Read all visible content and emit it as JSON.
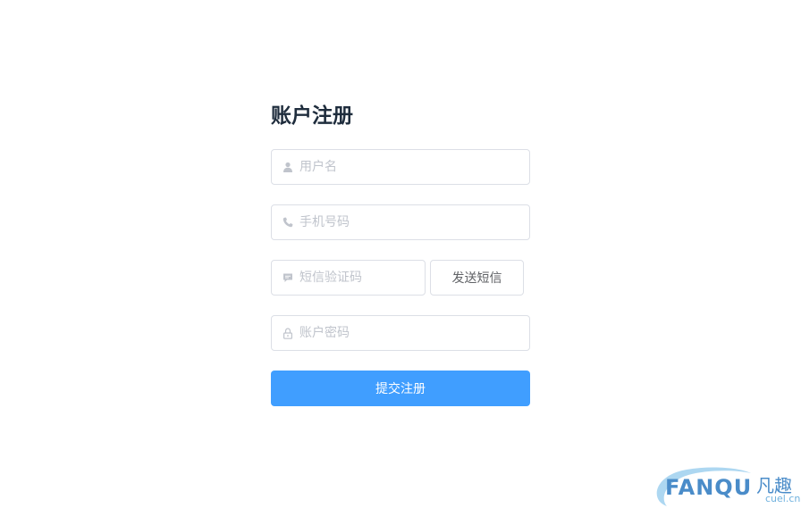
{
  "form": {
    "title": "账户注册",
    "username": {
      "placeholder": "用户名",
      "icon": "user-icon"
    },
    "phone": {
      "placeholder": "手机号码",
      "icon": "phone-icon"
    },
    "sms_code": {
      "placeholder": "短信验证码",
      "icon": "message-icon"
    },
    "send_sms_label": "发送短信",
    "password": {
      "placeholder": "账户密码",
      "icon": "lock-icon"
    },
    "submit_label": "提交注册"
  },
  "watermark": {
    "brand_en": "FANQU",
    "brand_cn": "凡趣",
    "domain": "cuel.cn"
  },
  "colors": {
    "primary": "#409eff",
    "border": "#dcdfe6",
    "placeholder": "#c0c4cc",
    "title": "#1f2d3d",
    "watermark": "#4a8cc9"
  }
}
